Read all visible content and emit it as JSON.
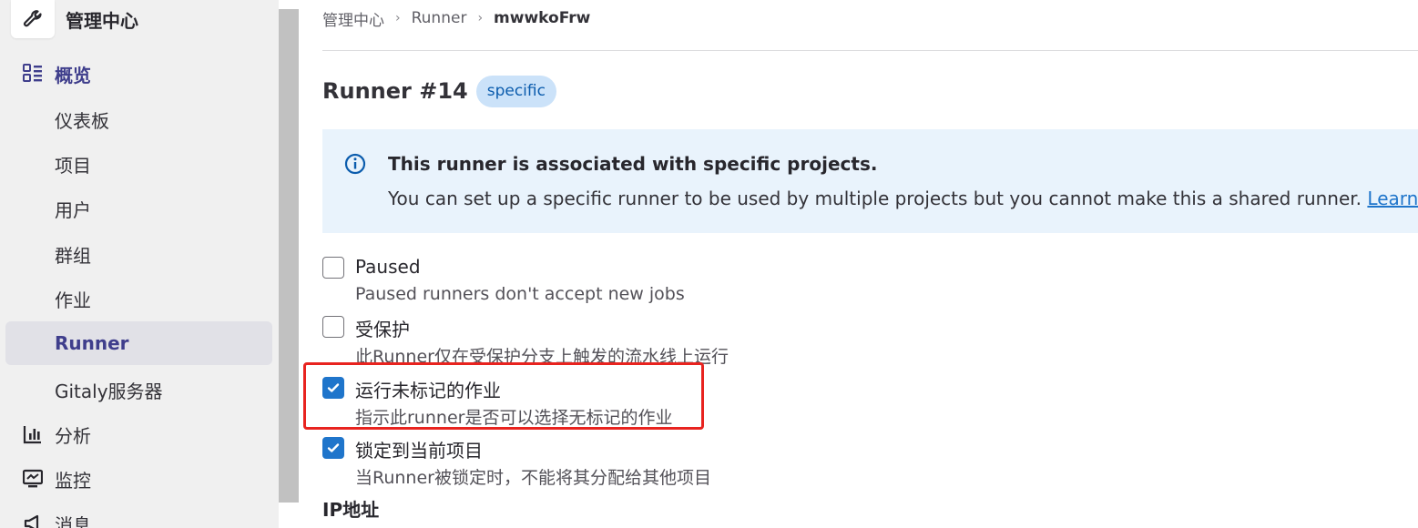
{
  "sidebar": {
    "brand_title": "管理中心",
    "overview_label": "概览",
    "items": [
      {
        "label": "仪表板"
      },
      {
        "label": "项目"
      },
      {
        "label": "用户"
      },
      {
        "label": "群组"
      },
      {
        "label": "作业"
      },
      {
        "label": "Runner"
      },
      {
        "label": "Gitaly服务器"
      }
    ],
    "analytics_label": "分析",
    "monitoring_label": "监控",
    "messages_label": "消息"
  },
  "breadcrumb": {
    "items": [
      "管理中心",
      "Runner",
      "mwwkoFrw"
    ]
  },
  "page": {
    "title": "Runner #14",
    "badge": "specific"
  },
  "alert": {
    "title": "This runner is associated with specific projects.",
    "body": "You can set up a specific runner to be used by multiple projects but you cannot make this a shared runner.",
    "link": "Learn more."
  },
  "options": [
    {
      "label": "Paused",
      "help": "Paused runners don't accept new jobs",
      "checked": false
    },
    {
      "label": "受保护",
      "help": "此Runner仅在受保护分支上触发的流水线上运行",
      "checked": false
    },
    {
      "label": "运行未标记的作业",
      "help": "指示此runner是否可以选择无标记的作业",
      "checked": true
    },
    {
      "label": "锁定到当前项目",
      "help": "当Runner被锁定时，不能将其分配给其他项目",
      "checked": true
    }
  ],
  "ip_section": {
    "heading": "IP地址"
  },
  "colors": {
    "accent": "#1f75cb",
    "active_nav": "#3f3e8c",
    "highlight": "#e8231f"
  }
}
